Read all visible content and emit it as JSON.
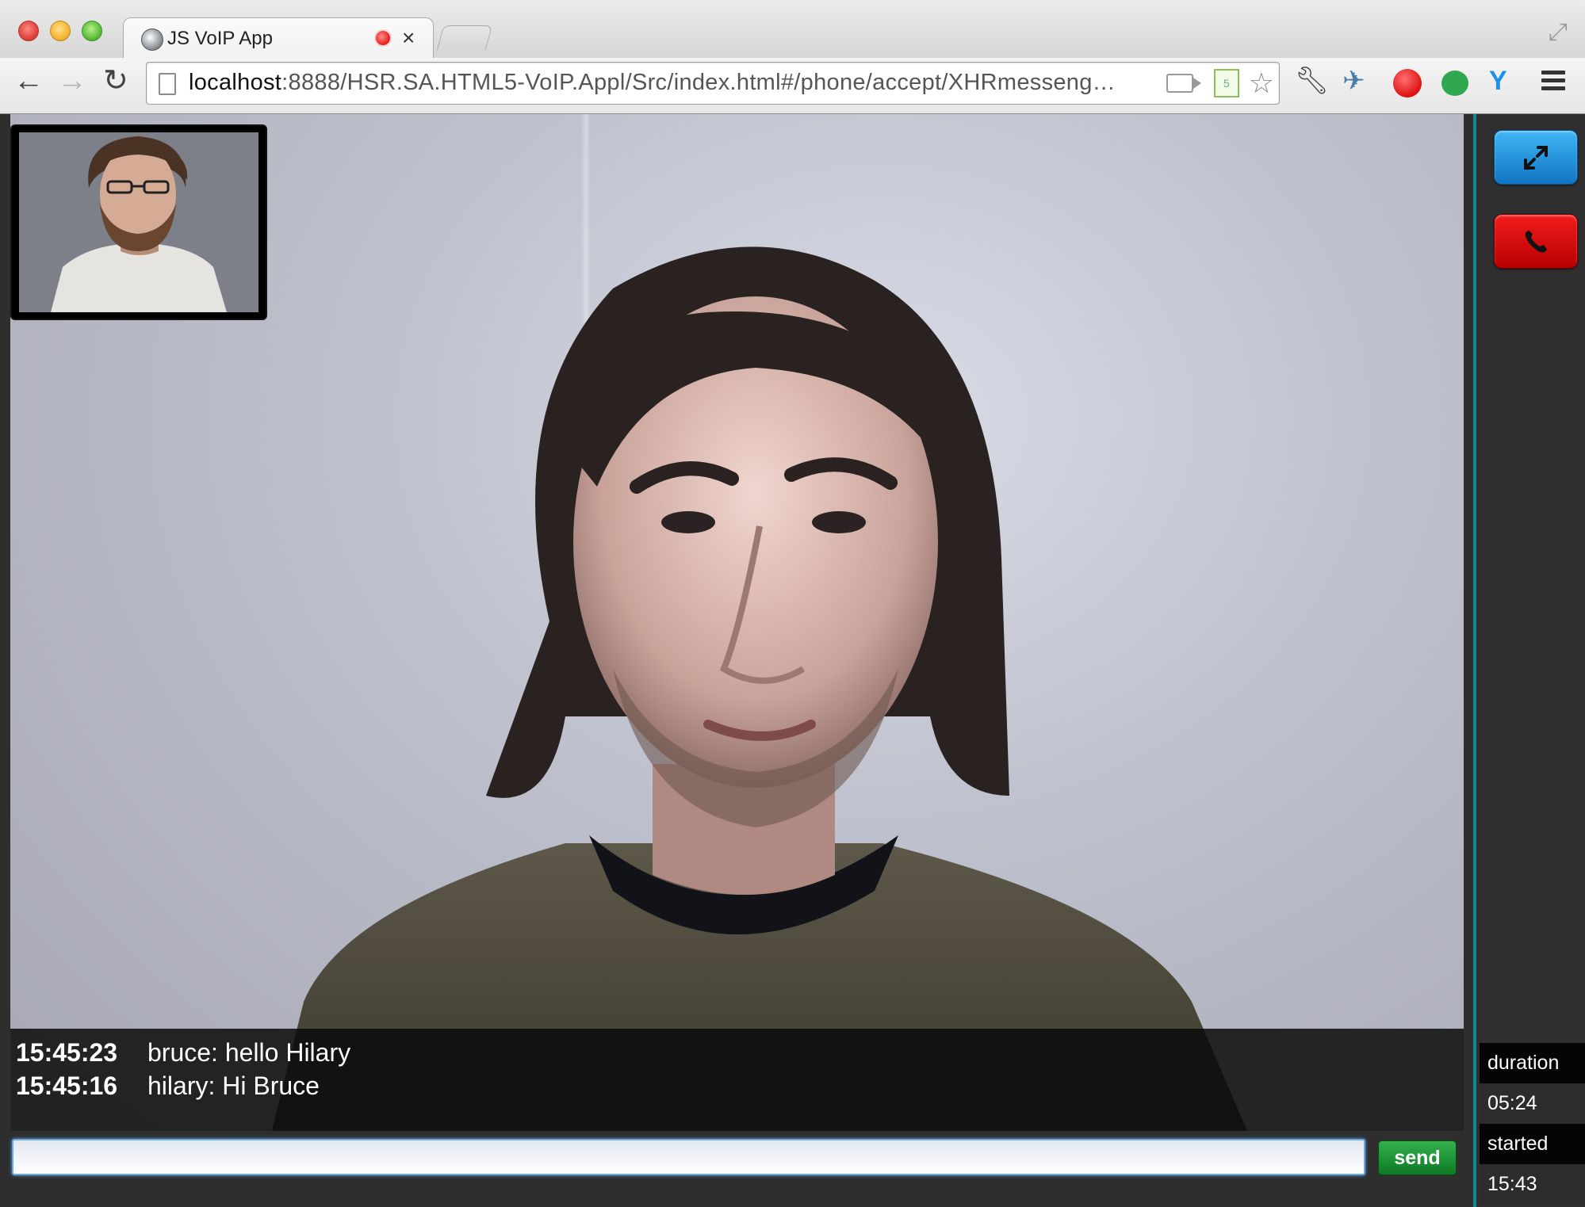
{
  "browser": {
    "tab_title": "JS VoIP App",
    "tab_close": "×",
    "url_host": "localhost",
    "url_rest": ":8888/HSR.SA.HTML5-VoIP.Appl/Src/index.html#/phone/accept/XHRmesseng…"
  },
  "chat": {
    "messages": [
      {
        "time": "15:45:23",
        "text": "bruce: hello Hilary"
      },
      {
        "time": "15:45:16",
        "text": "hilary: Hi Bruce"
      }
    ],
    "input_value": "",
    "send_label": "send"
  },
  "call_info": {
    "duration_label": "duration",
    "duration_value": "05:24",
    "started_label": "started",
    "started_value": "15:43"
  },
  "colors": {
    "sidebar_accent": "#0e8b8f",
    "expand_button": "#1e8fdc",
    "hangup_button": "#d40000",
    "send_button": "#1f9a38"
  },
  "icons": [
    "globe-icon",
    "record-icon",
    "close-icon",
    "back-icon",
    "forward-icon",
    "reload-icon",
    "page-icon",
    "camera-icon",
    "html5-icon",
    "star-icon",
    "wrench-icon",
    "bird-icon",
    "adblock-icon",
    "chat-ext-icon",
    "y-ext-icon",
    "menu-icon",
    "expand-icon",
    "phone-icon"
  ]
}
